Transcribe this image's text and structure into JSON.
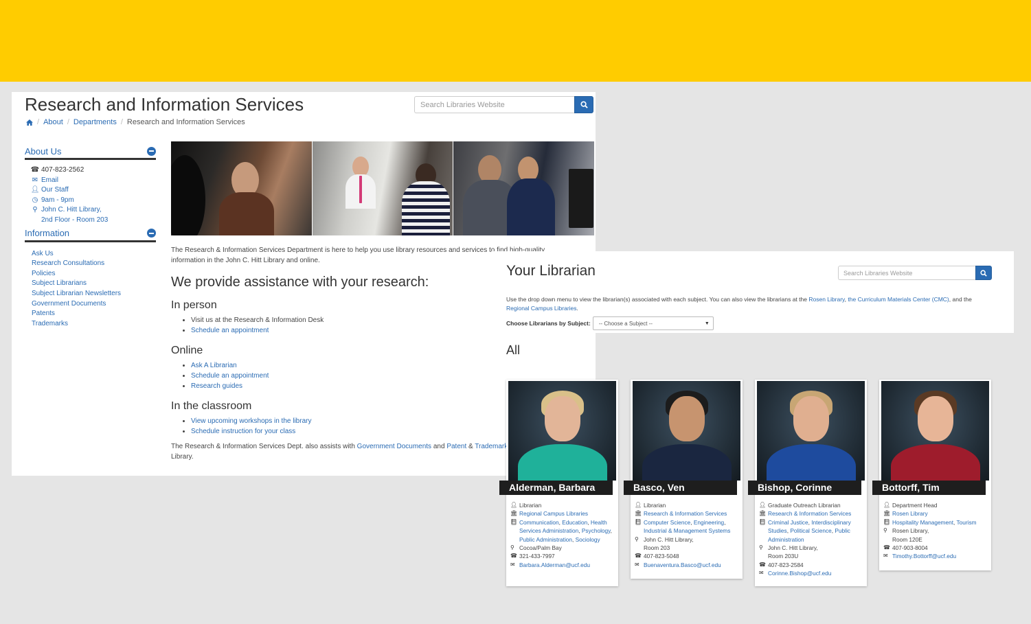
{
  "page1": {
    "title": "Research and Information Services",
    "search_placeholder": "Search Libraries Website",
    "breadcrumb": {
      "about": "About",
      "departments": "Departments",
      "current": "Research and Information Services"
    },
    "about": {
      "heading": "About Us",
      "phone": "407-823-2562",
      "email": "Email",
      "staff": "Our Staff",
      "hours": "9am - 9pm",
      "location_line1": "John C. Hitt Library,",
      "location_line2": "2nd Floor - Room 203"
    },
    "information": {
      "heading": "Information",
      "items": [
        "Ask Us",
        "Research Consultations",
        "Policies",
        "Subject Librarians",
        "Subject Librarian Newsletters",
        "Government Documents",
        "Patents",
        "Trademarks"
      ]
    },
    "intro": "The Research & Information Services Department is here to help you use library resources and services to find high-quality information in the John C. Hitt Library and online.",
    "assist_heading": "We provide assistance with your research:",
    "in_person": {
      "heading": "In person",
      "item1": "Visit us at the Research & Information Desk",
      "item2": "Schedule an appointment"
    },
    "online": {
      "heading": "Online",
      "item1": "Ask A Librarian",
      "item2": "Schedule an appointment",
      "item3": "Research guides"
    },
    "classroom": {
      "heading": "In the classroom",
      "item1": "View upcoming workshops in the library",
      "item2": "Schedule instruction for your class"
    },
    "outro": {
      "text1": "The Research & Information Services Dept. also assists with ",
      "gov": "Government Documents",
      "and": " and ",
      "patent": "Patent",
      "amp": " & ",
      "trade": "Trademarks",
      "text2": " in the John C. Hitt Library."
    }
  },
  "page2": {
    "title": "Your Librarian",
    "search_placeholder": "Search Libraries Website",
    "desc": {
      "text1": "Use the drop down menu to view the librarian(s) associated with each subject. You can also view the librarians at the ",
      "rosen": "Rosen Library",
      "comma": ", ",
      "cmc": "the Curriculum Materials Center (CMC)",
      "and": ", and the ",
      "regional": "Regional Campus Libraries",
      "period": "."
    },
    "choose_label": "Choose Librarians by Subject:",
    "select_value": "-- Choose a Subject --",
    "all_heading": "All",
    "cards": [
      {
        "name": "Alderman, Barbara",
        "role": "Librarian",
        "dept": "Regional Campus Libraries",
        "subjects": [
          {
            "t": "Communication",
            "link": true
          },
          {
            "t": ", ",
            "link": false
          },
          {
            "t": "Education",
            "link": true
          },
          {
            "t": ", ",
            "link": false
          },
          {
            "t": "Health Services Administration",
            "link": true
          },
          {
            "t": ", ",
            "link": false
          },
          {
            "t": "Psychology",
            "link": true
          },
          {
            "t": ", ",
            "link": false
          },
          {
            "t": "Public Administration",
            "link": true
          },
          {
            "t": ", ",
            "link": false
          },
          {
            "t": "Sociology",
            "link": true
          }
        ],
        "location": "Cocoa/Palm Bay",
        "phone": "321-433-7997",
        "email": "Barbara.Alderman@ucf.edu"
      },
      {
        "name": "Basco, Ven",
        "role": "Librarian",
        "dept": "Research & Information Services",
        "subjects": [
          {
            "t": "Computer Science",
            "link": true
          },
          {
            "t": ", ",
            "link": false
          },
          {
            "t": "Engineering",
            "link": true
          },
          {
            "t": ", ",
            "link": false
          },
          {
            "t": "Industrial & Management Systems",
            "link": true
          }
        ],
        "location_line1": "John C. Hitt Library,",
        "location_line2": "Room 203",
        "phone": "407-823-5048",
        "email": "Buenaventura.Basco@ucf.edu"
      },
      {
        "name": "Bishop, Corinne",
        "role": "Graduate Outreach Librarian",
        "dept": "Research & Information Services",
        "subjects": [
          {
            "t": "Criminal Justice",
            "link": true
          },
          {
            "t": ", ",
            "link": false
          },
          {
            "t": "Interdisciplinary Studies",
            "link": true
          },
          {
            "t": ", ",
            "link": false
          },
          {
            "t": "Political Science",
            "link": true
          },
          {
            "t": ", ",
            "link": false
          },
          {
            "t": "Public Administration",
            "link": true
          }
        ],
        "location_line1": "John C. Hitt Library,",
        "location_line2": "Room 203U",
        "phone": "407-823-2584",
        "email": "Corinne.Bishop@ucf.edu"
      },
      {
        "name": "Bottorff, Tim",
        "role": "Department Head",
        "dept": "Rosen Library",
        "subjects": [
          {
            "t": "Hospitality Management",
            "link": true
          },
          {
            "t": ", ",
            "link": false
          },
          {
            "t": "Tourism",
            "link": true
          }
        ],
        "location_line1": "Rosen Library,",
        "location_line2": "Room 120E",
        "phone": "407-903-8004",
        "email": "Timothy.Bottorff@ucf.edu"
      }
    ]
  },
  "colors": {
    "top_bar": "#ffcc00",
    "link": "#2a6bb3",
    "background": "#e5e5e5",
    "nameplate": "#1e1e1e"
  }
}
